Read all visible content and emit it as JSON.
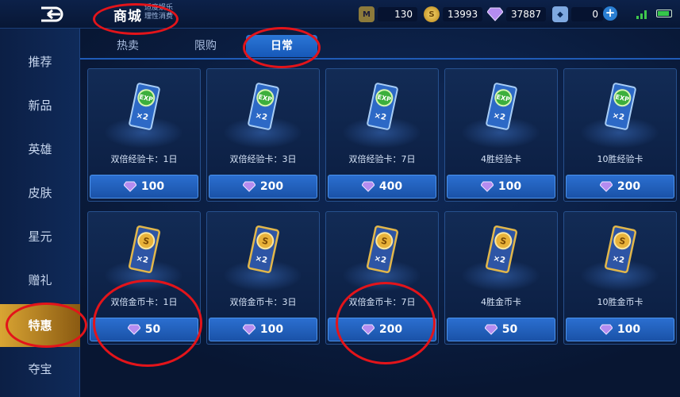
{
  "header": {
    "title": "商城",
    "subtitle_line1": "适度娱乐",
    "subtitle_line2": "理性消费"
  },
  "resources": {
    "tickets": "130",
    "gold": "13993",
    "diamonds": "37887",
    "vouchers": "0"
  },
  "sidebar": {
    "items": [
      {
        "label": "推荐"
      },
      {
        "label": "新品"
      },
      {
        "label": "英雄"
      },
      {
        "label": "皮肤"
      },
      {
        "label": "星元"
      },
      {
        "label": "赠礼"
      },
      {
        "label": "特惠"
      },
      {
        "label": "夺宝"
      }
    ],
    "active_index": 6
  },
  "tabs": {
    "items": [
      {
        "label": "热卖"
      },
      {
        "label": "限购"
      },
      {
        "label": "日常"
      }
    ],
    "active_index": 2
  },
  "cards": [
    {
      "title": "双倍经验卡：1日",
      "price": "100",
      "type": "exp"
    },
    {
      "title": "双倍经验卡：3日",
      "price": "200",
      "type": "exp"
    },
    {
      "title": "双倍经验卡：7日",
      "price": "400",
      "type": "exp"
    },
    {
      "title": "4胜经验卡",
      "price": "100",
      "type": "exp"
    },
    {
      "title": "10胜经验卡",
      "price": "200",
      "type": "exp"
    },
    {
      "title": "双倍金币卡：1日",
      "price": "50",
      "type": "gold"
    },
    {
      "title": "双倍金币卡：3日",
      "price": "100",
      "type": "gold"
    },
    {
      "title": "双倍金币卡：7日",
      "price": "200",
      "type": "gold"
    },
    {
      "title": "4胜金币卡",
      "price": "50",
      "type": "gold"
    },
    {
      "title": "10胜金币卡",
      "price": "100",
      "type": "gold"
    }
  ],
  "card_art": {
    "exp_badge": "EXP",
    "multiplier": "×2"
  },
  "colors": {
    "accent": "#2b76d6",
    "active_sidebar": "#d9a533",
    "annotation": "#e3141a",
    "gem": "#b58cf0"
  }
}
